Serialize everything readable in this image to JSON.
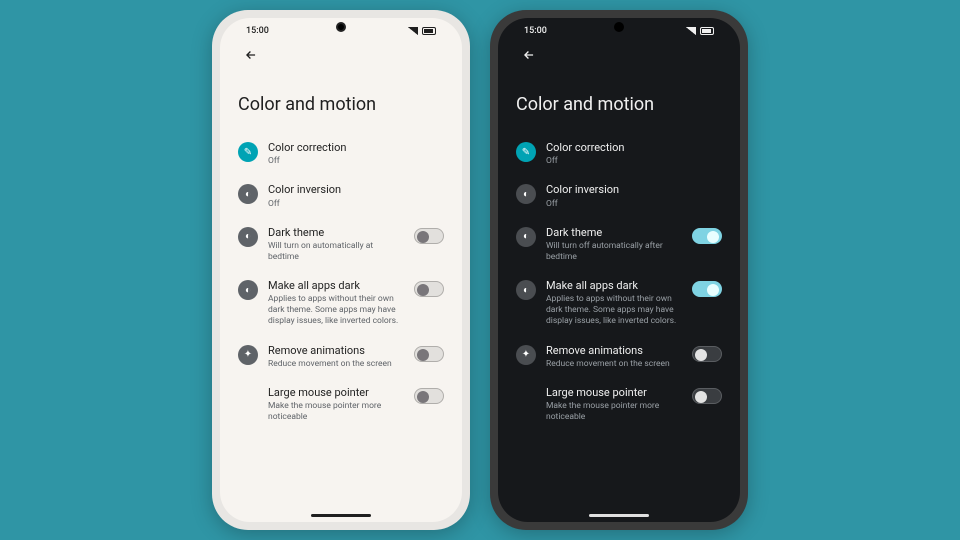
{
  "time": "15:00",
  "phones": [
    {
      "theme": "light",
      "title": "Color and motion",
      "items": [
        {
          "kind": "link",
          "icon": "teal",
          "glyph": "✎",
          "name": "color-correction",
          "label": "Color correction",
          "sub": "Off"
        },
        {
          "kind": "link",
          "icon": "gray",
          "glyph": "◐",
          "name": "color-inversion",
          "label": "Color inversion",
          "sub": "Off"
        },
        {
          "kind": "toggle",
          "icon": "gray",
          "glyph": "◐",
          "name": "dark-theme",
          "label": "Dark theme",
          "sub": "Will turn on automatically at bedtime",
          "on": false
        },
        {
          "kind": "toggle",
          "icon": "gray",
          "glyph": "◐",
          "name": "make-all-apps-dark",
          "label": "Make all apps dark",
          "sub": "Applies to apps without their own dark theme. Some apps may have display issues, like inverted colors.",
          "on": false
        },
        {
          "kind": "toggle",
          "icon": "gray",
          "glyph": "✦",
          "name": "remove-animations",
          "label": "Remove animations",
          "sub": "Reduce movement on the screen",
          "on": false
        },
        {
          "kind": "toggle",
          "icon": null,
          "name": "large-mouse-pointer",
          "label": "Large mouse pointer",
          "sub": "Make the mouse pointer more noticeable",
          "on": false
        }
      ]
    },
    {
      "theme": "dark",
      "title": "Color and motion",
      "items": [
        {
          "kind": "link",
          "icon": "teal",
          "glyph": "✎",
          "name": "color-correction",
          "label": "Color correction",
          "sub": "Off"
        },
        {
          "kind": "link",
          "icon": "gray",
          "glyph": "◐",
          "name": "color-inversion",
          "label": "Color inversion",
          "sub": "Off"
        },
        {
          "kind": "toggle",
          "icon": "gray",
          "glyph": "◐",
          "name": "dark-theme",
          "label": "Dark theme",
          "sub": "Will turn off automatically after bedtime",
          "on": true
        },
        {
          "kind": "toggle",
          "icon": "gray",
          "glyph": "◐",
          "name": "make-all-apps-dark",
          "label": "Make all apps dark",
          "sub": "Applies to apps without their own dark theme. Some apps may have display issues, like inverted colors.",
          "on": true
        },
        {
          "kind": "toggle",
          "icon": "gray",
          "glyph": "✦",
          "name": "remove-animations",
          "label": "Remove animations",
          "sub": "Reduce movement on the screen",
          "on": false
        },
        {
          "kind": "toggle",
          "icon": null,
          "name": "large-mouse-pointer",
          "label": "Large mouse pointer",
          "sub": "Make the mouse pointer more noticeable",
          "on": false
        }
      ]
    }
  ]
}
